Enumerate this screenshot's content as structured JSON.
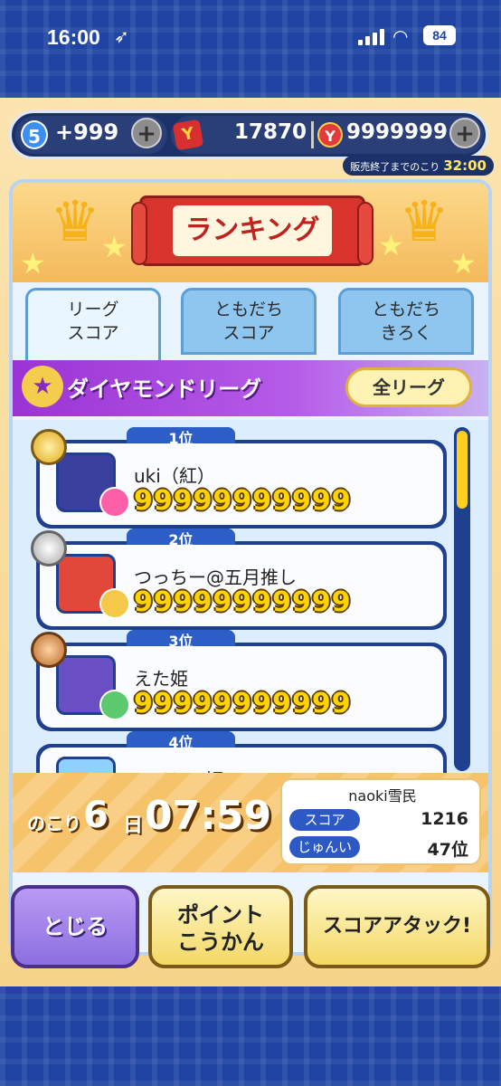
{
  "status_bar": {
    "time": "16:00",
    "battery": "84"
  },
  "currency": {
    "stamina_level": "5",
    "stamina_value": "+999",
    "tickets": "17870",
    "coins": "9999999",
    "sale_label": "販売終了までのこり",
    "sale_time": "32:00"
  },
  "header": {
    "title": "ランキング"
  },
  "tabs": [
    {
      "line1": "リーグ",
      "line2": "スコア"
    },
    {
      "line1": "ともだち",
      "line2": "スコア"
    },
    {
      "line1": "ともだち",
      "line2": "きろく"
    }
  ],
  "league": {
    "name": "ダイヤモンドリーグ",
    "all_league_button": "全リーグ"
  },
  "rankings": [
    {
      "rank": "1位",
      "name": "uki（紅）",
      "score": "99999999999",
      "medal": "gold",
      "avatar_color": "#3b3f9e",
      "sub_color": "#ff5fa8"
    },
    {
      "rank": "2位",
      "name": "つっちー@五月推し",
      "score": "99999999999",
      "medal": "silver",
      "avatar_color": "#e2483a",
      "sub_color": "#f5c84a"
    },
    {
      "rank": "3位",
      "name": "えた姫",
      "score": "99999999999",
      "medal": "bronze",
      "avatar_color": "#6a4fc4",
      "sub_color": "#5cc96e"
    },
    {
      "rank": "4位",
      "name": "アイシア姫",
      "score": "",
      "medal": "none",
      "avatar_color": "#8fd0ff",
      "sub_color": "#8fd0ff"
    }
  ],
  "footer": {
    "remain_label": "のこり",
    "remain_days": "6",
    "day_unit": "日",
    "remain_time": "07:59",
    "my_name": "naoki雪民",
    "score_label": "スコア",
    "score_value": "1216",
    "rank_label": "じゅんい",
    "rank_value": "47位"
  },
  "buttons": {
    "close": "とじる",
    "points_line1": "ポイント",
    "points_line2": "こうかん",
    "score_attack": "スコアアタック!"
  }
}
